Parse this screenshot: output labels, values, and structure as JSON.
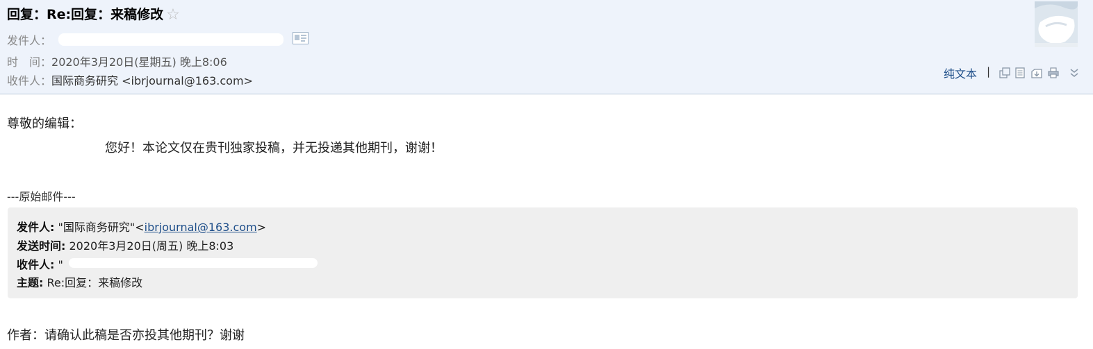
{
  "header": {
    "subject": "回复：Re:回复：来稿修改",
    "sender_label": "发件人：",
    "time_label": "时　间：",
    "time_value": "2020年3月20日(星期五) 晚上8:06",
    "recipient_label": "收件人：",
    "recipient_value": "国际商务研究 <ibrjournal@163.com>",
    "icons": [
      "star-icon",
      "contact-card-icon",
      "avatar"
    ],
    "actions": {
      "plain_text": "纯文本",
      "separator": "|",
      "icons": [
        "new-window-icon",
        "document-icon",
        "download-icon",
        "print-icon",
        "more-chevron-icon"
      ]
    }
  },
  "body": {
    "greeting": "尊敬的编辑：",
    "message": "您好！本论文仅在贵刊独家投稿，并无投递其他期刊，谢谢！",
    "original_divider": "---原始邮件---",
    "original": {
      "from_label": "发件人:",
      "from_name": " \"国际商务研究\"<",
      "from_email": "ibrjournal@163.com",
      "from_close": ">",
      "sent_label": "发送时间:",
      "sent_value": " 2020年3月20日(周五) 晚上8:03",
      "to_label": "收件人:",
      "to_value": " \"",
      "subject_label": "主题:",
      "subject_value": " Re:回复：来稿修改"
    },
    "quoted_text": "作者：请确认此稿是否亦投其他期刊？谢谢"
  },
  "colors": {
    "header_bg": "#eef3fb",
    "link": "#1f4f8a",
    "quote_bg": "#efefef"
  }
}
